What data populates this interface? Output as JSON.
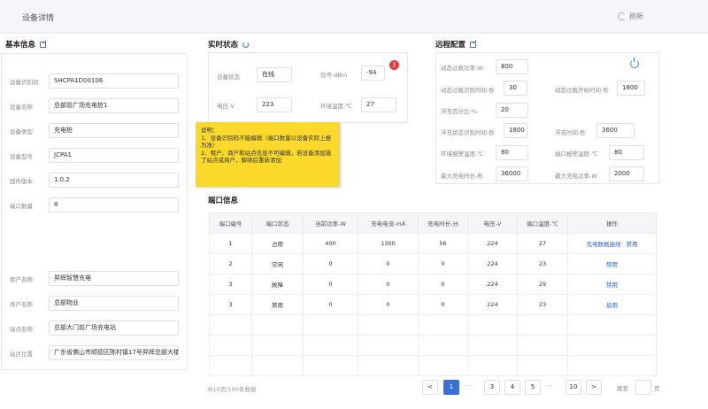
{
  "header": {
    "title": "设备详情",
    "refresh_label": "刷新"
  },
  "basic": {
    "title": "基本信息",
    "fields": [
      {
        "label": "设备识别码",
        "value": "SHCPA1D00106"
      },
      {
        "label": "设备名称",
        "value": "总部前广场充电桩1"
      },
      {
        "label": "设备类型",
        "value": "充电桩"
      },
      {
        "label": "设备型号",
        "value": "JCPA1"
      },
      {
        "label": "固件版本",
        "value": "1.0.2"
      },
      {
        "label": "端口数量",
        "value": "8"
      },
      {
        "label": "租户名称",
        "value": "昇辉智慧充电"
      },
      {
        "label": "商户名称",
        "value": "总部物业"
      },
      {
        "label": "站点名称",
        "value": "总部大门前广场充电站"
      },
      {
        "label": "站点位置",
        "value": "广东省佛山市顺德区陈村镇17号昇辉总部大楼"
      }
    ]
  },
  "realtime": {
    "title": "实时状态",
    "fields": [
      {
        "label": "设备状态",
        "value": "在线"
      },
      {
        "label": "信号-dBm",
        "value": "-94"
      },
      {
        "label": "电压-V",
        "value": "223"
      },
      {
        "label": "环境温度-℃",
        "value": "27"
      }
    ],
    "alert_glyph": "!"
  },
  "remote": {
    "title": "远程配置",
    "fields": [
      {
        "label": "动态过载功率-W",
        "value": "800"
      },
      {
        "label": "动态过载识别时间-秒",
        "value": "30"
      },
      {
        "label": "动态过载开始时间-秒",
        "value": "1800"
      },
      {
        "label": "浮充百分比-%",
        "value": "20"
      },
      {
        "label": "浮充状态识别时间-秒",
        "value": "1800"
      },
      {
        "label": "浮充时间-秒",
        "value": "3600"
      },
      {
        "label": "环境报警温度-℃",
        "value": "80"
      },
      {
        "label": "端口报警温度-℃",
        "value": "80"
      },
      {
        "label": "最大充电时长-秒",
        "value": "36000"
      },
      {
        "label": "最大充电功率-W",
        "value": "2000"
      }
    ]
  },
  "tooltip": {
    "lines": [
      "说明：",
      "1、设备识别码不能编辑（端口数量以设备实际上报为准）",
      "2、租户、商户和站点信息不可编辑，若设备添加错了站点或商户，解绑后重新添加"
    ]
  },
  "ports": {
    "title": "端口信息",
    "columns": [
      "端口编号",
      "端口状态",
      "当前功率-W",
      "充电电流-mA",
      "充电时长-分",
      "电压-V",
      "端口温度-℃",
      "操作"
    ],
    "rows": [
      {
        "cells": [
          "1",
          "占用",
          "400",
          "1300",
          "56",
          "224",
          "27"
        ],
        "actions": [
          "充电数据曲线",
          "禁用"
        ]
      },
      {
        "cells": [
          "2",
          "空闲",
          "0",
          "0",
          "0",
          "224",
          "23"
        ],
        "actions": [
          "禁用"
        ]
      },
      {
        "cells": [
          "3",
          "故障",
          "0",
          "0",
          "0",
          "224",
          "29"
        ],
        "actions": [
          "禁用"
        ]
      },
      {
        "cells": [
          "3",
          "禁用",
          "0",
          "0",
          "0",
          "224",
          "23"
        ],
        "actions": [
          "启用"
        ]
      }
    ]
  },
  "pagination": {
    "total_text": "共10页/100条数据",
    "prev": "<",
    "next": ">",
    "pages": [
      "1",
      "3",
      "4",
      "5",
      "10"
    ],
    "ellipsis": "···",
    "current": "1",
    "goto_label": "跳至",
    "goto_suffix": "页"
  }
}
